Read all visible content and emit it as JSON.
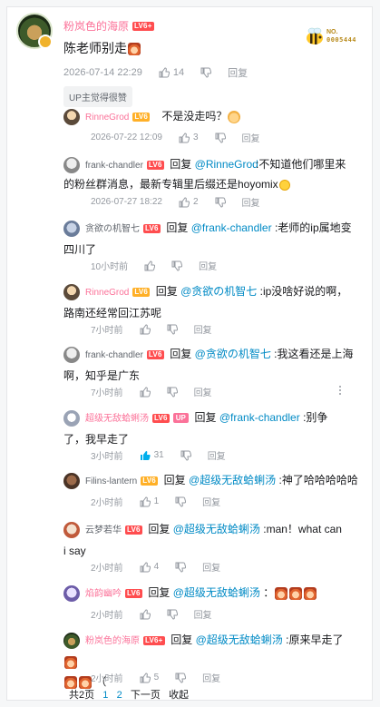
{
  "root": {
    "username": "粉岚色的海原",
    "level": "LV6+",
    "text": "陈老师别走",
    "time": "2026-07-14 22:29",
    "likes": "14",
    "reply_label": "回复",
    "up_liked": "UP主觉得很赞",
    "badge": {
      "line1": "NO.",
      "line2": "0005444"
    }
  },
  "replies": [
    {
      "user": "RinneGrod",
      "level": "LV6",
      "reply_to": "",
      "text": "不是没走吗？",
      "time": "2026-07-22 12:09",
      "likes": "3",
      "reply_label": "回复"
    },
    {
      "user": "frank-chandler",
      "level": "LV6",
      "reply_to": "@RinneGrod",
      "text": ":不知道他们哪里来的粉丝群消息，最新专辑里后缀还是hoyomix",
      "time": "2026-07-27 18:22",
      "likes": "2",
      "reply_label": "回复"
    },
    {
      "user": "贪欲の机智七",
      "level": "LV6",
      "reply_to": "@frank-chandler",
      "text": ":老师的ip属地变四川了",
      "time": "10小时前",
      "likes": "",
      "reply_label": "回复"
    },
    {
      "user": "RinneGrod",
      "level": "LV6",
      "reply_to": "@贪欲の机智七",
      "text": ":ip没啥好说的啊，路南还经常回江苏呢",
      "time": "7小时前",
      "likes": "",
      "reply_label": "回复"
    },
    {
      "user": "frank-chandler",
      "level": "LV6",
      "reply_to": "@贪欲の机智七",
      "text": ":我这看还是上海啊，知乎是广东",
      "time": "7小时前",
      "likes": "",
      "reply_label": "回复"
    },
    {
      "user": "超级无敌蛤蜊汤",
      "level": "LV6",
      "up": "UP",
      "reply_to": "@frank-chandler",
      "text": ":别争了，我早走了",
      "time": "3小时前",
      "likes": "31",
      "reply_label": "回复"
    },
    {
      "user": "Filins-lantern",
      "level": "LV6",
      "reply_to": "@超级无敌蛤蜊汤",
      "text": ":神了哈哈哈哈哈",
      "time": "2小时前",
      "likes": "1",
      "reply_label": "回复"
    },
    {
      "user": "云梦若华",
      "level": "LV6",
      "reply_to": "@超级无敌蛤蜊汤",
      "text": ":man！what can i say",
      "time": "2小时前",
      "likes": "4",
      "reply_label": "回复"
    },
    {
      "user": "焰韵幽吟",
      "level": "LV6",
      "reply_to": "@超级无敌蛤蜊汤",
      "text": "：",
      "time": "2小时前",
      "likes": "",
      "reply_label": "回复"
    },
    {
      "user": "粉岚色的海原",
      "level": "LV6+",
      "reply_to": "@超级无敌蛤蜊汤",
      "text": ":原来早走了",
      "text2": "（",
      "time": "2小时前",
      "likes": "5",
      "reply_label": "回复"
    }
  ],
  "pager": {
    "total": "共2页",
    "p1": "1",
    "p2": "2",
    "next": "下一页",
    "collapse": "收起"
  },
  "common": {
    "reply_word": "回复"
  },
  "colors": {
    "accent_pink": "#fb7299",
    "link_blue": "#008ac5",
    "meta_gray": "#9499a0"
  }
}
